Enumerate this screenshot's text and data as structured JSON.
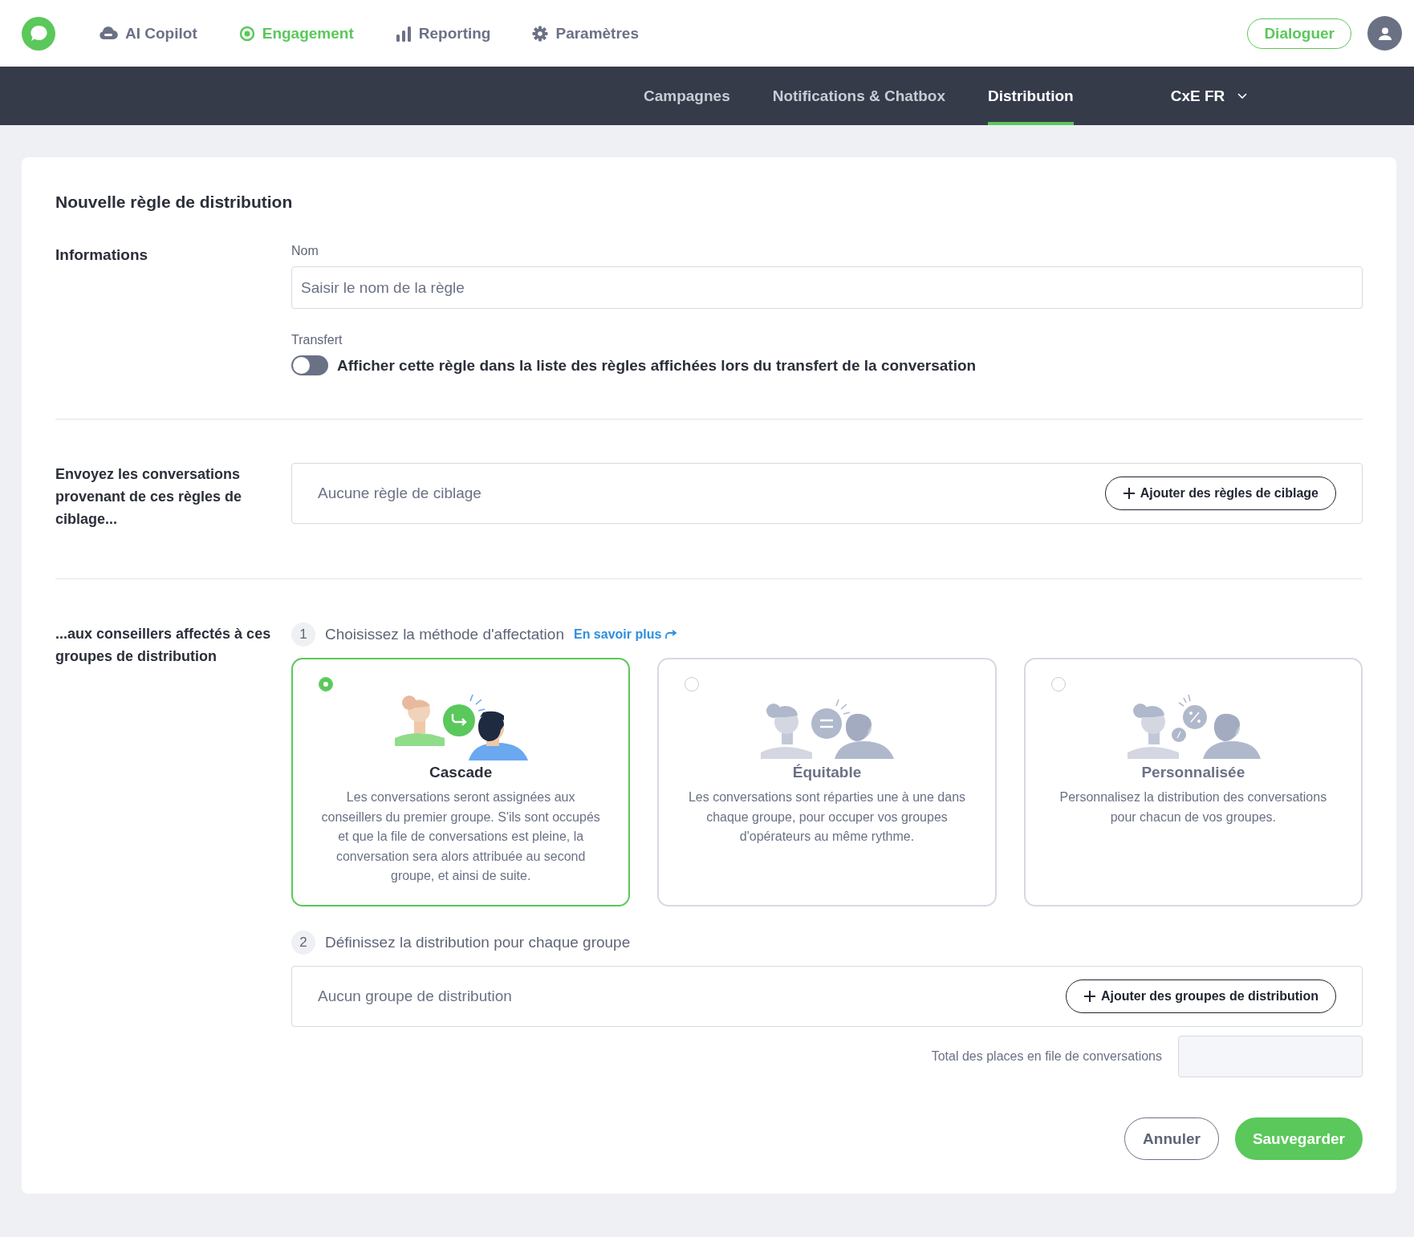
{
  "nav": {
    "items": [
      {
        "label": "AI Copilot",
        "kind": "cloud",
        "selected": false
      },
      {
        "label": "Engagement",
        "kind": "target",
        "selected": true
      },
      {
        "label": "Reporting",
        "kind": "bars",
        "selected": false
      },
      {
        "label": "Paramètres",
        "kind": "gear",
        "selected": false
      }
    ],
    "action": "Dialoguer"
  },
  "subnav": {
    "tabs": [
      {
        "label": "Campagnes",
        "selected": false
      },
      {
        "label": "Notifications & Chatbox",
        "selected": false
      },
      {
        "label": "Distribution",
        "selected": true
      }
    ],
    "workspace": "CxE FR"
  },
  "form": {
    "title": "Nouvelle règle de distribution",
    "informations": {
      "heading": "Informations",
      "name_label": "Nom",
      "name_placeholder": "Saisir le nom de la règle",
      "transfer_label": "Transfert",
      "transfer_toggle": {
        "on": false,
        "label": "Afficher cette règle dans la liste des règles affichées lors du transfert de la conversation"
      }
    },
    "targeting": {
      "heading": "Envoyez les conversations provenant de ces règles de ciblage...",
      "empty": "Aucune règle de ciblage",
      "button": "Ajouter des règles de ciblage"
    },
    "groups": {
      "heading": "...aux conseillers affectés à ces groupes de distribution",
      "step1": {
        "number": "1",
        "label": "Choisissez la méthode d'affectation",
        "link": "En savoir plus"
      },
      "methods": [
        {
          "kind": "cascade",
          "title": "Cascade",
          "description": "Les conversations seront assignées aux conseillers du premier groupe. S'ils sont occupés et que la file de conversations est pleine, la conversation sera alors attribuée au second groupe, et ainsi de suite.",
          "selected": true
        },
        {
          "kind": "equal",
          "title": "Équitable",
          "description": "Les conversations sont réparties une à une dans chaque groupe, pour occuper vos groupes d'opérateurs au même rythme.",
          "selected": false
        },
        {
          "kind": "custom",
          "title": "Personnalisée",
          "description": "Personnalisez la distribution des conversations pour chacun de vos groupes.",
          "selected": false
        }
      ],
      "step2": {
        "number": "2",
        "label": "Définissez la distribution pour chaque groupe"
      },
      "empty": "Aucun groupe de distribution",
      "button": "Ajouter des groupes de distribution",
      "total_label": "Total des places en file de conversations"
    },
    "buttons": {
      "cancel": "Annuler",
      "save": "Sauvegarder"
    }
  }
}
